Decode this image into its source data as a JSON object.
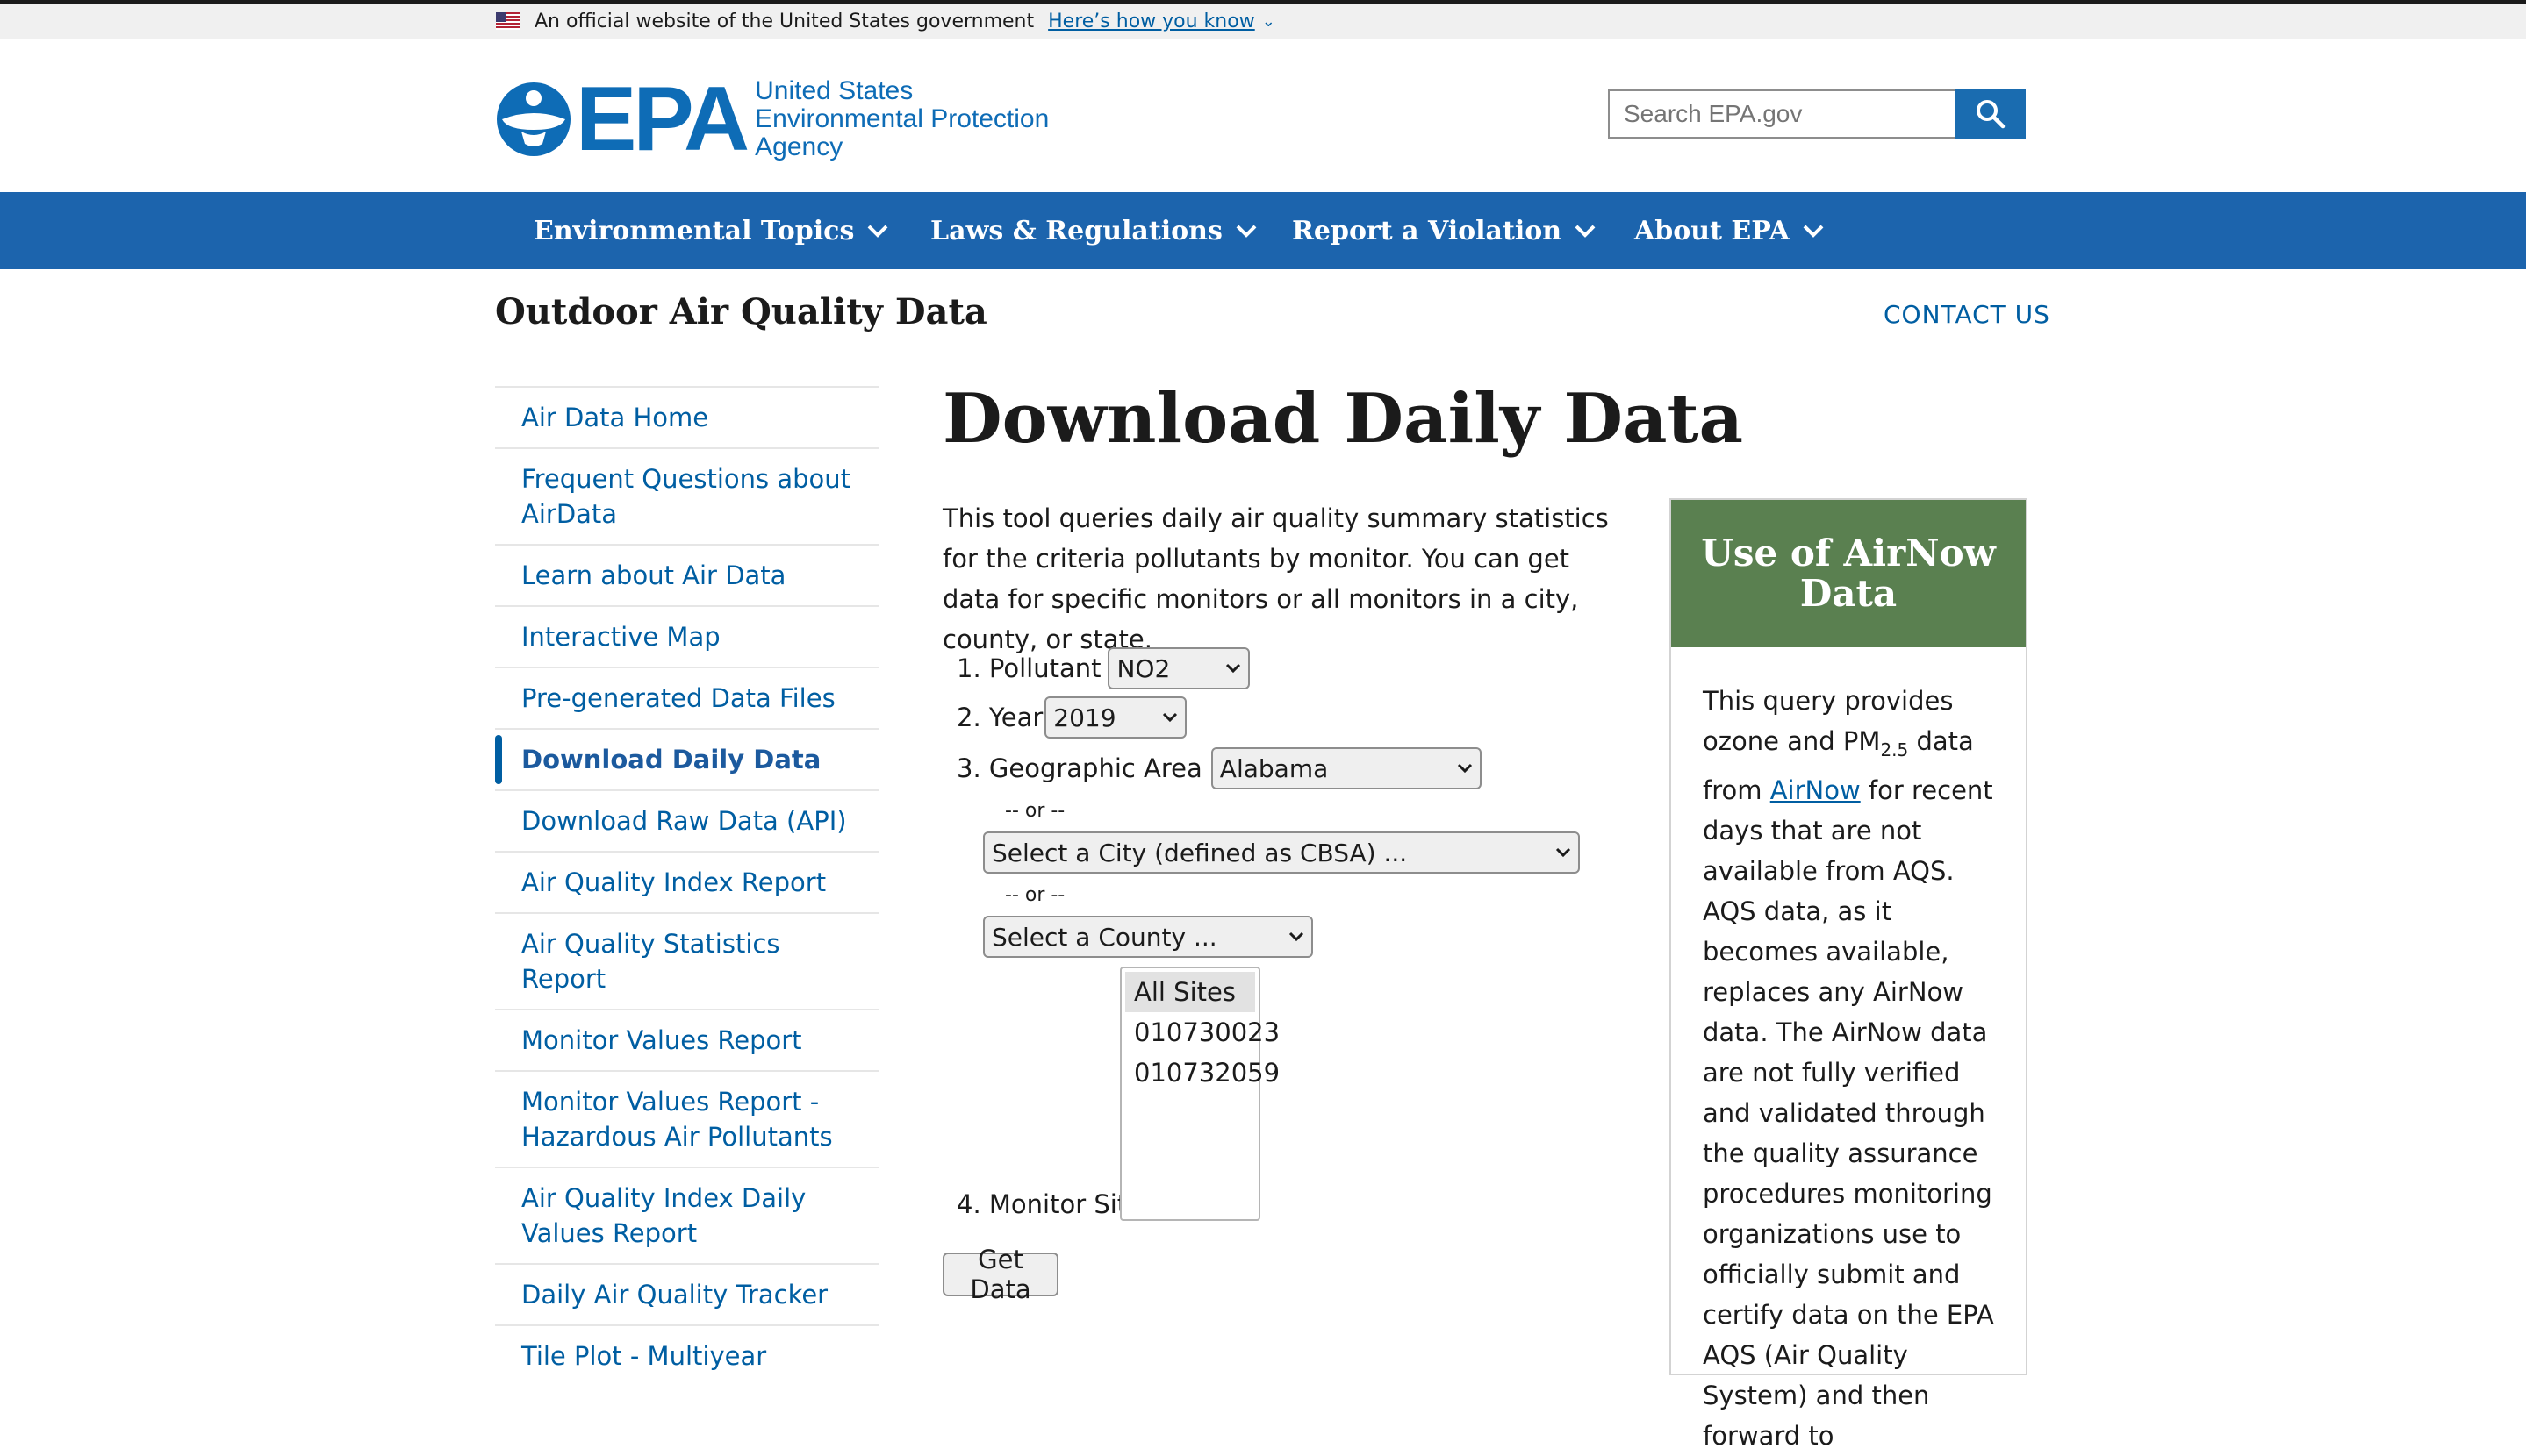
{
  "gov_banner": {
    "text": "An official website of the United States government",
    "link": "Here’s how you know"
  },
  "header": {
    "logo_text": "EPA",
    "agency_name": [
      "United States",
      "Environmental Protection",
      "Agency"
    ],
    "search_placeholder": "Search EPA.gov"
  },
  "nav": {
    "items": [
      {
        "label": "Environmental Topics"
      },
      {
        "label": "Laws & Regulations"
      },
      {
        "label": "Report a Violation"
      },
      {
        "label": "About EPA"
      }
    ]
  },
  "page": {
    "section_title": "Outdoor Air Quality Data",
    "contact": "CONTACT US",
    "title": "Download Daily Data",
    "intro": "This tool queries daily air quality summary statistics for the criteria pollutants by monitor. You can get data for specific monitors or all monitors in a city, county, or state."
  },
  "sidenav": {
    "items": [
      {
        "label": "Air Data Home"
      },
      {
        "label": "Frequent Questions about AirData"
      },
      {
        "label": "Learn about Air Data"
      },
      {
        "label": "Interactive Map"
      },
      {
        "label": "Pre-generated Data Files"
      },
      {
        "label": "Download Daily Data",
        "current": true
      },
      {
        "label": "Download Raw Data (API)"
      },
      {
        "label": "Air Quality Index Report"
      },
      {
        "label": "Air Quality Statistics Report"
      },
      {
        "label": "Monitor Values Report"
      },
      {
        "label": "Monitor Values Report - Hazardous Air Pollutants"
      },
      {
        "label": "Air Quality Index Daily Values Report"
      },
      {
        "label": "Daily Air Quality Tracker"
      },
      {
        "label": "Tile Plot - Multiyear"
      }
    ]
  },
  "form": {
    "pollutant_label": "1. Pollutant",
    "pollutant_value": "NO2",
    "year_label": "2. Year",
    "year_value": "2019",
    "geo_label": "3. Geographic Area",
    "geo_value": "Alabama",
    "or_text": "-- or --",
    "city_value": "Select a City (defined as CBSA) ...",
    "county_value": "Select a County ...",
    "site_label": "4. Monitor Site",
    "site_options": [
      "All Sites",
      "010730023",
      "010732059"
    ],
    "get_data": "Get Data"
  },
  "sidebox": {
    "title": "Use of AirNow Data",
    "body_1": "This query provides ozone and PM",
    "body_sub": "2.5",
    "body_2": " data from ",
    "link": "AirNow",
    "body_3": " for recent days that are not available from AQS. AQS data, as it becomes available, replaces any AirNow data. The AirNow data are not fully verified and validated through the quality assurance procedures monitoring organizations use to officially submit and certify data on the EPA AQS (Air Quality System) and then forward to"
  },
  "colors": {
    "nav_bg": "#1c64ad",
    "link": "#005ea2",
    "box_header": "#5a8050"
  }
}
